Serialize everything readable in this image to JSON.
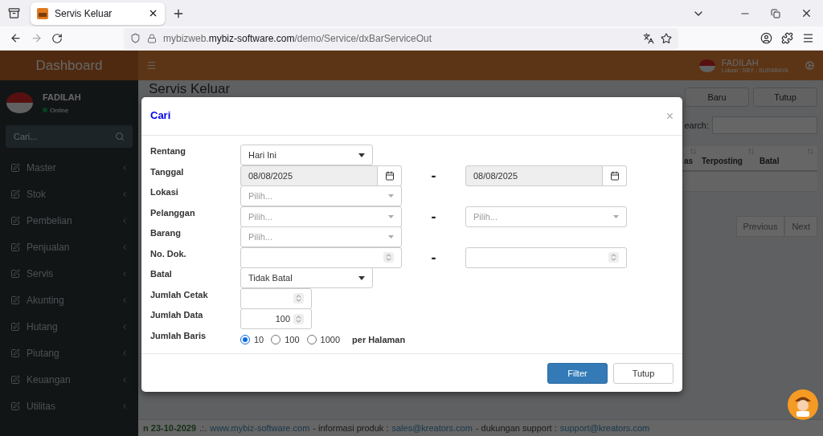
{
  "browser": {
    "tabs": [
      {
        "title": "Servis Keluar",
        "selected": true
      }
    ],
    "url": {
      "prefix": "mybizweb.",
      "domain": "mybiz-software.com",
      "path": "/demo/Service/dxBarServiceOut"
    }
  },
  "header": {
    "brand": "Dashboard",
    "user": "FADILAH",
    "location": "Lokasi : SBY - SURABAYA"
  },
  "sidebar": {
    "user": "FADILAH",
    "status": "Online",
    "search_placeholder": "Cari...",
    "items": [
      "Master",
      "Stok",
      "Pembelian",
      "Penjualan",
      "Servis",
      "Akunting",
      "Hutang",
      "Piutang",
      "Keuangan",
      "Utilitas"
    ]
  },
  "page": {
    "title": "Servis Keluar",
    "buttons": [
      "Baru",
      "Tutup"
    ],
    "search_label": "earch:",
    "columns": [
      "as",
      "Terposting",
      "Batal"
    ],
    "pagination": [
      "Previous",
      "Next"
    ]
  },
  "footer": {
    "date": "n 23-10-2029",
    "separator": ".:.",
    "site": "www.mybiz-software.com",
    "info_label": "- informasi produk :",
    "info_email": "sales@kreators.com",
    "support_label": "- dukungan support :",
    "support_email": "support@kreators.com"
  },
  "modal": {
    "title": "Cari",
    "close": "×",
    "rows": [
      {
        "label": "Rentang",
        "kind": "select",
        "fields": [
          {
            "value": "Hari Ini"
          }
        ]
      },
      {
        "label": "Tanggal",
        "kind": "date",
        "separator": "-",
        "fields": [
          {
            "value": "08/08/2025",
            "disabled": true
          },
          {
            "value": "08/08/2025",
            "disabled": true
          }
        ]
      },
      {
        "label": "Lokasi",
        "kind": "combo",
        "fields": [
          {
            "placeholder": "Pilih..."
          }
        ]
      },
      {
        "label": "Pelanggan",
        "kind": "combo",
        "separator": "-",
        "fields": [
          {
            "placeholder": "Pilih..."
          },
          {
            "placeholder": "Pilih..."
          }
        ]
      },
      {
        "label": "Barang",
        "kind": "combo",
        "fields": [
          {
            "placeholder": "Pilih..."
          }
        ]
      },
      {
        "label": "No. Dok.",
        "kind": "number",
        "separator": "-"
      },
      {
        "label": "Batal",
        "kind": "select",
        "fields": [
          {
            "value": "Tidak Batal"
          }
        ]
      },
      {
        "label": "Jumlah Cetak",
        "kind": "spinner"
      },
      {
        "label": "Jumlah Data",
        "kind": "spinner",
        "fields": [
          {
            "value": "100"
          }
        ]
      },
      {
        "label": "Jumlah Baris",
        "kind": "radio",
        "options": [
          {
            "label": "10",
            "selected": true
          },
          {
            "label": "100",
            "selected": false
          },
          {
            "label": "1000",
            "selected": false
          }
        ],
        "suffix": "per Halaman"
      }
    ],
    "buttons": [
      {
        "label": "Filter",
        "primary": true
      },
      {
        "label": "Tutup",
        "primary": false
      }
    ]
  }
}
